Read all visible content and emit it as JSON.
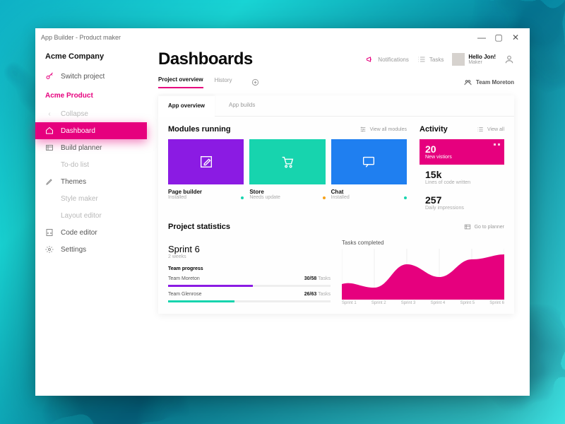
{
  "window": {
    "title": "App Builder - Product maker"
  },
  "sidebar": {
    "company": "Acme Company",
    "switch_label": "Switch project",
    "project_name": "Acme Product",
    "items": [
      {
        "label": "Collapse"
      },
      {
        "label": "Dashboard"
      },
      {
        "label": "Build planner"
      },
      {
        "label": "To-do list"
      },
      {
        "label": "Themes"
      },
      {
        "label": "Style maker"
      },
      {
        "label": "Layout editor"
      },
      {
        "label": "Code editor"
      },
      {
        "label": "Settings"
      }
    ]
  },
  "header": {
    "title": "Dashboards",
    "notifications": "Notifications",
    "tasks": "Tasks",
    "user_name": "Hello Jon!",
    "user_role": "Maker"
  },
  "tabs1": {
    "overview": "Project overview",
    "history": "History",
    "team_label": "Team Moreton"
  },
  "panel": {
    "tabs": {
      "app_overview": "App overview",
      "app_builds": "App builds"
    },
    "modules_title": "Modules running",
    "view_all_modules": "View all modules",
    "activity_title": "Activity",
    "view_all": "View all",
    "cards": [
      {
        "name": "Page builder",
        "status": "Installed",
        "color": "purple"
      },
      {
        "name": "Store",
        "status": "Needs update",
        "color": "teal"
      },
      {
        "name": "Chat",
        "status": "Installed",
        "color": "blue"
      }
    ],
    "metrics": [
      {
        "value": "20",
        "label": "New vistiors"
      },
      {
        "value": "15k",
        "label": "Lines of code written"
      },
      {
        "value": "257",
        "label": "Daily impressions"
      }
    ],
    "stats_title": "Project statistics",
    "go_planner": "Go to planner",
    "sprint": "Sprint 6",
    "sprint_sub": "2 weeks",
    "team_progress": "Team progress",
    "teams": [
      {
        "name": "Team Moreton",
        "done": "30/58",
        "unit": "Tasks",
        "pct": 52
      },
      {
        "name": "Team Glenrose",
        "done": "26/63",
        "unit": "Tasks",
        "pct": 41
      }
    ],
    "chart_title": "Tasks completed"
  },
  "chart_data": {
    "type": "area",
    "title": "Tasks completed",
    "categories": [
      "Sprint 1",
      "Sprint 2",
      "Sprint 3",
      "Sprint 4",
      "Sprint 5",
      "Sprint 6"
    ],
    "values": [
      28,
      22,
      48,
      35,
      55,
      60
    ],
    "ylim": [
      0,
      70
    ],
    "xlabel": "",
    "ylabel": ""
  }
}
